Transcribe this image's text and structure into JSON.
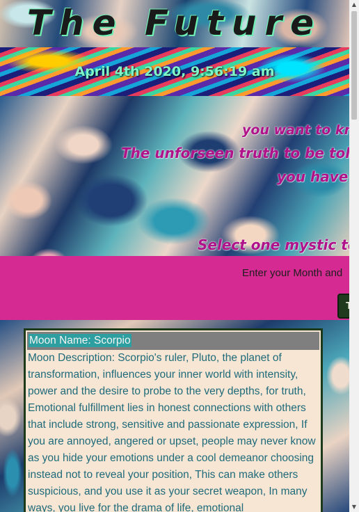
{
  "header": {
    "title": "The Future",
    "datetime": "April 4th 2020, 9:56:19 am"
  },
  "intro": {
    "lines": [
      "you want to kn",
      "The unforseen truth to be told,",
      "you have ",
      "Select one mystic te"
    ]
  },
  "form": {
    "prompt": "Enter your Month and",
    "button_label": "T"
  },
  "moon": {
    "name_label": "Moon Name: Scorpio",
    "description": "Moon Description: Scorpio's ruler, Pluto, the planet of transformation, influences your inner world with intensity, power and the desire to probe to the very depths, for truth, Emotional fulfillment lies in honest connections with others that include strong, sensitive and passionate expression, If you are annoyed, angered or upset, people may never know as you hide your emotions under a cool demeanor choosing instead not to reveal your position, This can make others suspicious, and you use it as your secret weapon, In many ways, you live for the drama of life, emotional"
  },
  "scrollbar": {
    "up_icon": "triangle-up",
    "down_icon": "triangle-down"
  }
}
